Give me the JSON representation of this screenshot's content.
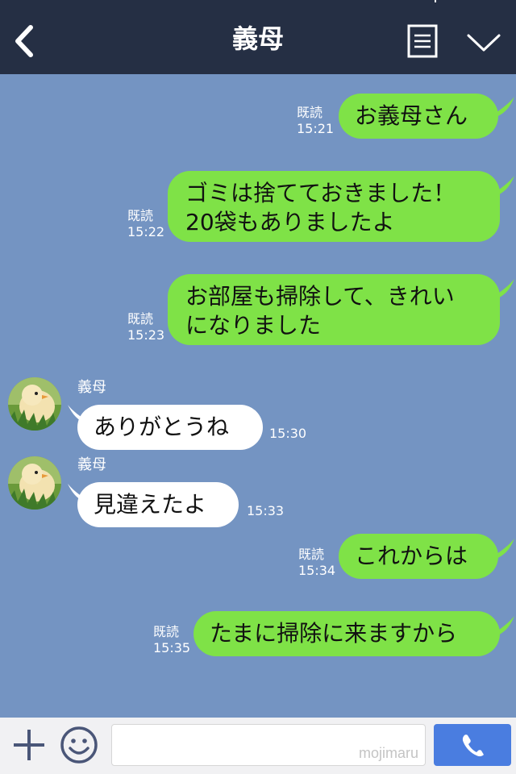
{
  "header": {
    "title": "義母",
    "back_icon": "chevron-left-icon",
    "menu_icon": "memo-list-icon",
    "dropdown_icon": "chevron-down-icon"
  },
  "contact": {
    "name": "義母",
    "avatar": "chick-photo"
  },
  "messages": [
    {
      "side": "out",
      "text": [
        "お義母さん"
      ],
      "read": "既読",
      "time": "15:21"
    },
    {
      "side": "out",
      "text": [
        "ゴミは捨てておきました！",
        "20袋もありましたよ"
      ],
      "read": "既読",
      "time": "15:22"
    },
    {
      "side": "out",
      "text": [
        "お部屋も掃除して、きれい",
        "になりました"
      ],
      "read": "既読",
      "time": "15:23"
    },
    {
      "side": "in",
      "sender": "義母",
      "text": [
        "ありがとうね"
      ],
      "time": "15:30"
    },
    {
      "side": "in",
      "sender": "義母",
      "text": [
        "見違えたよ"
      ],
      "time": "15:33"
    },
    {
      "side": "out",
      "text": [
        "これからは"
      ],
      "read": "既読",
      "time": "15:34"
    },
    {
      "side": "out",
      "text": [
        "たまに掃除に来ますから"
      ],
      "read": "既読",
      "time": "15:35"
    }
  ],
  "composer": {
    "plus_icon": "plus-icon",
    "emoji_icon": "smiley-icon",
    "input_value": "",
    "watermark": "mojimaru",
    "call_icon": "phone-icon"
  },
  "colors": {
    "header_bg": "#252f44",
    "chat_bg": "#7494c2",
    "outgoing_bubble": "#7fe247",
    "incoming_bubble": "#ffffff",
    "call_button": "#4a7de0"
  }
}
